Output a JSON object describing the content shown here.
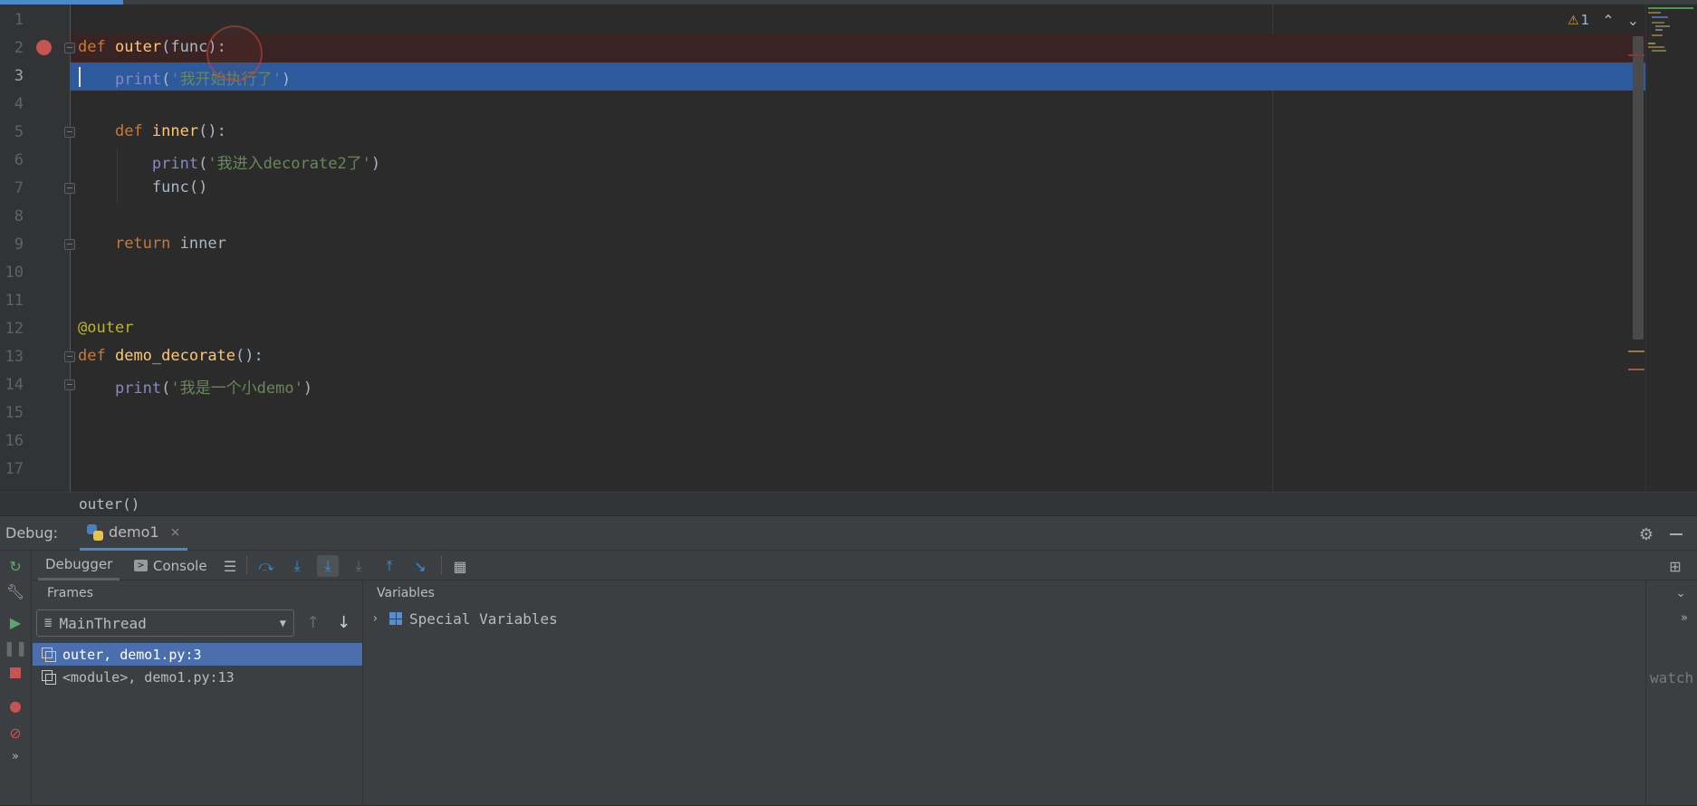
{
  "editor": {
    "lines": [
      {
        "n": "1"
      },
      {
        "n": "2"
      },
      {
        "n": "3"
      },
      {
        "n": "4"
      },
      {
        "n": "5"
      },
      {
        "n": "6"
      },
      {
        "n": "7"
      },
      {
        "n": "8"
      },
      {
        "n": "9"
      },
      {
        "n": "10"
      },
      {
        "n": "11"
      },
      {
        "n": "12"
      },
      {
        "n": "13"
      },
      {
        "n": "14"
      },
      {
        "n": "15"
      },
      {
        "n": "16"
      },
      {
        "n": "17"
      }
    ],
    "code": {
      "l2": {
        "kw": "def",
        "name": "outer",
        "rest": "(func):"
      },
      "l3": {
        "fn": "print",
        "open": "(",
        "str": "'我开始执行了'",
        "close": ")"
      },
      "l5": {
        "kw": "def",
        "name": "inner",
        "rest": "():"
      },
      "l6": {
        "fn": "print",
        "open": "(",
        "str": "'我进入decorate2了'",
        "close": ")"
      },
      "l7": {
        "text": "func()"
      },
      "l9": {
        "kw": "return",
        "rest": "inner"
      },
      "l12": {
        "dec": "@outer"
      },
      "l13": {
        "kw": "def",
        "name": "demo_decorate",
        "rest": "():"
      },
      "l14": {
        "fn": "print",
        "open": "(",
        "str": "'我是一个小demo'",
        "close": ")"
      }
    },
    "inspections": {
      "warning_count": "1",
      "warn_glyph": "⚠",
      "up": "⌃",
      "down": "⌄"
    },
    "breadcrumb": "outer()",
    "colors": {
      "breakpoint": "#c75450",
      "execution_line": "#2d5a9c",
      "keyword": "#cc7832"
    }
  },
  "debug": {
    "title": "Debug:",
    "session_tab": "demo1",
    "tab_close": "×",
    "tabs": {
      "debugger": "Debugger",
      "console": "Console"
    },
    "frames_label": "Frames",
    "thread": "MainThread",
    "frames": [
      {
        "label": "outer, demo1.py:3",
        "selected": true
      },
      {
        "label": "<module>, demo1.py:13",
        "selected": false
      }
    ],
    "variables_label": "Variables",
    "variables": [
      {
        "label": "Special Variables"
      }
    ],
    "watches_hint": "watch",
    "icons": {
      "rerun": "rerun-icon",
      "settings": "wrench-icon",
      "resume": "resume-icon",
      "pause": "pause-icon",
      "stop": "stop-icon",
      "view_breakpoints": "view-breakpoints-icon",
      "mute_breakpoints": "mute-breakpoints-icon",
      "step_over": "step-over-icon",
      "step_into": "step-into-icon",
      "step_into_my_code": "step-into-my-code-icon",
      "force_step_into": "force-step-into-icon",
      "step_out": "step-out-icon",
      "run_to_cursor": "run-to-cursor-icon",
      "evaluate": "evaluate-icon"
    }
  }
}
